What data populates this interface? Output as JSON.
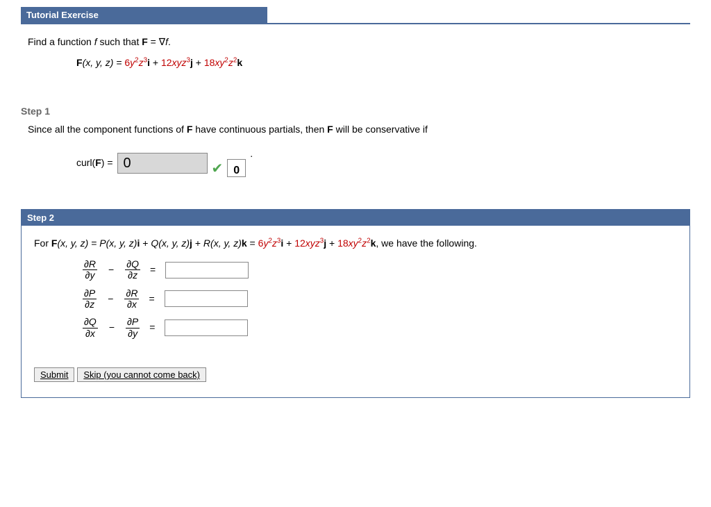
{
  "header": {
    "title": "Tutorial Exercise"
  },
  "problem": {
    "intro_a": "Find a function ",
    "intro_f": "f",
    "intro_b": " such that ",
    "intro_F": "F",
    "intro_c": " = ∇",
    "intro_f2": "f",
    "intro_d": ".",
    "formula_lhs_F": "F",
    "formula_lhs_rest": "(x, y, z) = ",
    "term1_coef": "6",
    "term1_vars": "y",
    "term1_exp1": "2",
    "term1_z": "z",
    "term1_exp2": "3",
    "term1_unit": "i",
    "plus1": " + ",
    "term2_coef": "12",
    "term2_vars": "xyz",
    "term2_exp": "3",
    "term2_unit": "j",
    "plus2": " + ",
    "term3_coef": "18",
    "term3_vars1": "xy",
    "term3_exp1": "2",
    "term3_z": "z",
    "term3_exp2": "2",
    "term3_unit": "k"
  },
  "step1": {
    "label": "Step 1",
    "text_a": "Since all the component functions of ",
    "text_F": "F",
    "text_b": " have continuous partials, then ",
    "text_F2": "F",
    "text_c": " will be conservative if",
    "curl_label_a": "curl(",
    "curl_label_F": "F",
    "curl_label_b": ") = ",
    "entered_value": "0",
    "correct_answer": "0",
    "period": "."
  },
  "step2": {
    "label": "Step 2",
    "for_a": "For  ",
    "for_F": "F",
    "for_b": "(x, y, z) = ",
    "P": "P",
    "pq_args": "(x, y, z)",
    "i": "i",
    "plus": " + ",
    "Q": "Q",
    "j": "j",
    "R": "R",
    "k": "k",
    "eq": " = ",
    "tail": ",  we have the following.",
    "row1": {
      "num1": "∂R",
      "den1": "∂y",
      "num2": "∂Q",
      "den2": "∂z",
      "value": ""
    },
    "row2": {
      "num1": "∂P",
      "den1": "∂z",
      "num2": "∂R",
      "den2": "∂x",
      "value": ""
    },
    "row3": {
      "num1": "∂Q",
      "den1": "∂x",
      "num2": "∂P",
      "den2": "∂y",
      "value": ""
    },
    "minus": "−",
    "equals": "="
  },
  "buttons": {
    "submit": "Submit",
    "skip": "Skip (you cannot come back)"
  }
}
